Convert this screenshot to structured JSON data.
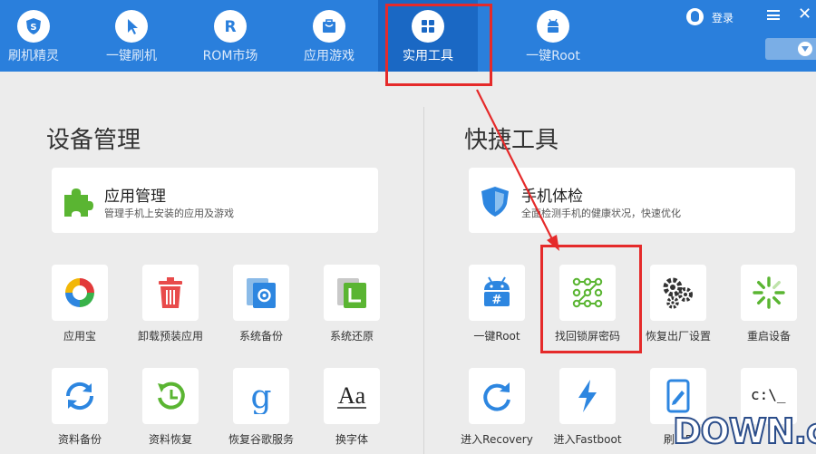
{
  "nav": {
    "items": [
      {
        "label": "刷机精灵"
      },
      {
        "label": "一键刷机"
      },
      {
        "label": "ROM市场"
      },
      {
        "label": "应用游戏"
      },
      {
        "label": "实用工具"
      },
      {
        "label": "一键Root"
      }
    ],
    "active": "实用工具",
    "login": "登录"
  },
  "device_management": {
    "title": "设备管理",
    "card": {
      "title": "应用管理",
      "desc": "管理手机上安装的应用及游戏"
    },
    "tiles": [
      {
        "label": "应用宝",
        "icon": "yingyongbao-icon"
      },
      {
        "label": "卸载预装应用",
        "icon": "trash-icon"
      },
      {
        "label": "系统备份",
        "icon": "system-backup-icon"
      },
      {
        "label": "系统还原",
        "icon": "system-restore-icon"
      },
      {
        "label": "资料备份",
        "icon": "sync-icon"
      },
      {
        "label": "资料恢复",
        "icon": "restore-clock-icon"
      },
      {
        "label": "恢复谷歌服务",
        "icon": "google-g-icon"
      },
      {
        "label": "换字体",
        "icon": "font-aa-icon"
      }
    ]
  },
  "quick_tools": {
    "title": "快捷工具",
    "card": {
      "title": "手机体检",
      "desc": "全面检测手机的健康状况，快速优化"
    },
    "tiles": [
      {
        "label": "一键Root",
        "icon": "android-root-icon"
      },
      {
        "label": "找回锁屏密码",
        "icon": "pattern-lock-icon"
      },
      {
        "label": "恢复出厂设置",
        "icon": "gears-icon"
      },
      {
        "label": "重启设备",
        "icon": "restart-spinner-icon"
      },
      {
        "label": "进入Recovery",
        "icon": "refresh-arrow-icon"
      },
      {
        "label": "进入Fastboot",
        "icon": "lightning-icon"
      },
      {
        "label": "刷入R",
        "icon": "tablet-edit-icon"
      },
      {
        "label": "c:\\_",
        "icon": "cmd-icon"
      }
    ]
  },
  "watermark": "DOWN.cc",
  "colors": {
    "nav_bg": "#2a7fdc",
    "nav_active": "#1a68c4",
    "highlight": "#e52a2a",
    "accent_blue": "#2d86e0",
    "green": "#5ab532"
  }
}
